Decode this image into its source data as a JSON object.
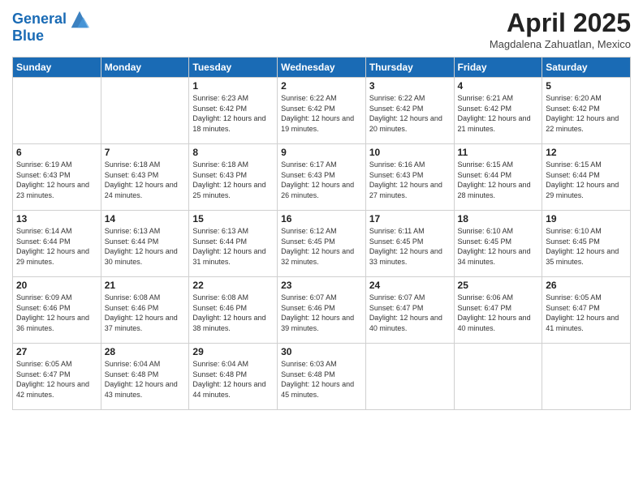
{
  "header": {
    "logo_line1": "General",
    "logo_line2": "Blue",
    "month": "April 2025",
    "location": "Magdalena Zahuatlan, Mexico"
  },
  "days_of_week": [
    "Sunday",
    "Monday",
    "Tuesday",
    "Wednesday",
    "Thursday",
    "Friday",
    "Saturday"
  ],
  "weeks": [
    [
      {
        "day": "",
        "info": ""
      },
      {
        "day": "",
        "info": ""
      },
      {
        "day": "1",
        "info": "Sunrise: 6:23 AM\nSunset: 6:42 PM\nDaylight: 12 hours and 18 minutes."
      },
      {
        "day": "2",
        "info": "Sunrise: 6:22 AM\nSunset: 6:42 PM\nDaylight: 12 hours and 19 minutes."
      },
      {
        "day": "3",
        "info": "Sunrise: 6:22 AM\nSunset: 6:42 PM\nDaylight: 12 hours and 20 minutes."
      },
      {
        "day": "4",
        "info": "Sunrise: 6:21 AM\nSunset: 6:42 PM\nDaylight: 12 hours and 21 minutes."
      },
      {
        "day": "5",
        "info": "Sunrise: 6:20 AM\nSunset: 6:42 PM\nDaylight: 12 hours and 22 minutes."
      }
    ],
    [
      {
        "day": "6",
        "info": "Sunrise: 6:19 AM\nSunset: 6:43 PM\nDaylight: 12 hours and 23 minutes."
      },
      {
        "day": "7",
        "info": "Sunrise: 6:18 AM\nSunset: 6:43 PM\nDaylight: 12 hours and 24 minutes."
      },
      {
        "day": "8",
        "info": "Sunrise: 6:18 AM\nSunset: 6:43 PM\nDaylight: 12 hours and 25 minutes."
      },
      {
        "day": "9",
        "info": "Sunrise: 6:17 AM\nSunset: 6:43 PM\nDaylight: 12 hours and 26 minutes."
      },
      {
        "day": "10",
        "info": "Sunrise: 6:16 AM\nSunset: 6:43 PM\nDaylight: 12 hours and 27 minutes."
      },
      {
        "day": "11",
        "info": "Sunrise: 6:15 AM\nSunset: 6:44 PM\nDaylight: 12 hours and 28 minutes."
      },
      {
        "day": "12",
        "info": "Sunrise: 6:15 AM\nSunset: 6:44 PM\nDaylight: 12 hours and 29 minutes."
      }
    ],
    [
      {
        "day": "13",
        "info": "Sunrise: 6:14 AM\nSunset: 6:44 PM\nDaylight: 12 hours and 29 minutes."
      },
      {
        "day": "14",
        "info": "Sunrise: 6:13 AM\nSunset: 6:44 PM\nDaylight: 12 hours and 30 minutes."
      },
      {
        "day": "15",
        "info": "Sunrise: 6:13 AM\nSunset: 6:44 PM\nDaylight: 12 hours and 31 minutes."
      },
      {
        "day": "16",
        "info": "Sunrise: 6:12 AM\nSunset: 6:45 PM\nDaylight: 12 hours and 32 minutes."
      },
      {
        "day": "17",
        "info": "Sunrise: 6:11 AM\nSunset: 6:45 PM\nDaylight: 12 hours and 33 minutes."
      },
      {
        "day": "18",
        "info": "Sunrise: 6:10 AM\nSunset: 6:45 PM\nDaylight: 12 hours and 34 minutes."
      },
      {
        "day": "19",
        "info": "Sunrise: 6:10 AM\nSunset: 6:45 PM\nDaylight: 12 hours and 35 minutes."
      }
    ],
    [
      {
        "day": "20",
        "info": "Sunrise: 6:09 AM\nSunset: 6:46 PM\nDaylight: 12 hours and 36 minutes."
      },
      {
        "day": "21",
        "info": "Sunrise: 6:08 AM\nSunset: 6:46 PM\nDaylight: 12 hours and 37 minutes."
      },
      {
        "day": "22",
        "info": "Sunrise: 6:08 AM\nSunset: 6:46 PM\nDaylight: 12 hours and 38 minutes."
      },
      {
        "day": "23",
        "info": "Sunrise: 6:07 AM\nSunset: 6:46 PM\nDaylight: 12 hours and 39 minutes."
      },
      {
        "day": "24",
        "info": "Sunrise: 6:07 AM\nSunset: 6:47 PM\nDaylight: 12 hours and 40 minutes."
      },
      {
        "day": "25",
        "info": "Sunrise: 6:06 AM\nSunset: 6:47 PM\nDaylight: 12 hours and 40 minutes."
      },
      {
        "day": "26",
        "info": "Sunrise: 6:05 AM\nSunset: 6:47 PM\nDaylight: 12 hours and 41 minutes."
      }
    ],
    [
      {
        "day": "27",
        "info": "Sunrise: 6:05 AM\nSunset: 6:47 PM\nDaylight: 12 hours and 42 minutes."
      },
      {
        "day": "28",
        "info": "Sunrise: 6:04 AM\nSunset: 6:48 PM\nDaylight: 12 hours and 43 minutes."
      },
      {
        "day": "29",
        "info": "Sunrise: 6:04 AM\nSunset: 6:48 PM\nDaylight: 12 hours and 44 minutes."
      },
      {
        "day": "30",
        "info": "Sunrise: 6:03 AM\nSunset: 6:48 PM\nDaylight: 12 hours and 45 minutes."
      },
      {
        "day": "",
        "info": ""
      },
      {
        "day": "",
        "info": ""
      },
      {
        "day": "",
        "info": ""
      }
    ]
  ]
}
